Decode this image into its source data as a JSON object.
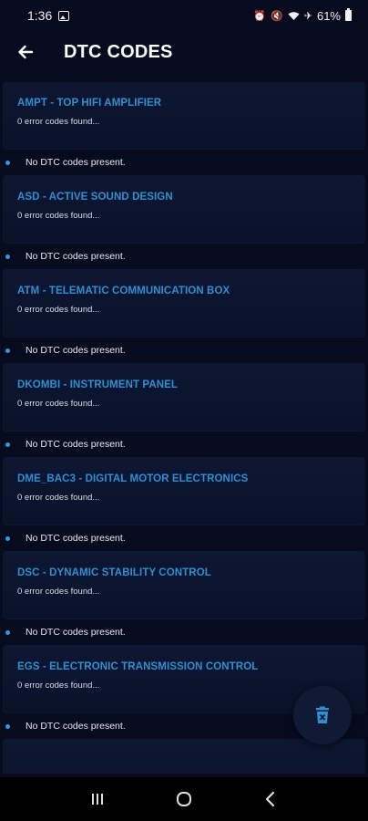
{
  "status_bar": {
    "time": "1:36",
    "battery": "61%",
    "left_icons": [
      "gallery-icon"
    ],
    "right_icons": [
      "alarm-icon",
      "mute-icon",
      "wifi-icon",
      "airplane-icon",
      "battery-icon"
    ]
  },
  "header": {
    "title": "DTC CODES",
    "back_icon": "arrow-left-icon"
  },
  "modules": [
    {
      "title": "AMPT - TOP HIFI AMPLIFIER",
      "count": "0 error codes found...",
      "dtc": "No DTC codes present."
    },
    {
      "title": "ASD - ACTIVE SOUND DESIGN",
      "count": "0 error codes found...",
      "dtc": "No DTC codes present."
    },
    {
      "title": "ATM - TELEMATIC COMMUNICATION BOX",
      "count": "0 error codes found...",
      "dtc": "No DTC codes present."
    },
    {
      "title": "DKOMBI - INSTRUMENT PANEL",
      "count": "0 error codes found...",
      "dtc": "No DTC codes present."
    },
    {
      "title": "DME_BAC3 - DIGITAL MOTOR ELECTRONICS",
      "count": "0 error codes found...",
      "dtc": "No DTC codes present."
    },
    {
      "title": "DSC - DYNAMIC STABILITY CONTROL",
      "count": "0 error codes found...",
      "dtc": "No DTC codes present."
    },
    {
      "title": "EGS - ELECTRONIC TRANSMISSION CONTROL",
      "count": "0 error codes found...",
      "dtc": "No DTC codes present."
    }
  ],
  "fab": {
    "icon": "trash-icon"
  },
  "nav_bar": {
    "icons": [
      "recents-icon",
      "home-icon",
      "back-icon"
    ]
  },
  "colors": {
    "background": "#070b1e",
    "card": "#0e1733",
    "accent": "#2f8fd0",
    "dot": "#2f9be6"
  }
}
